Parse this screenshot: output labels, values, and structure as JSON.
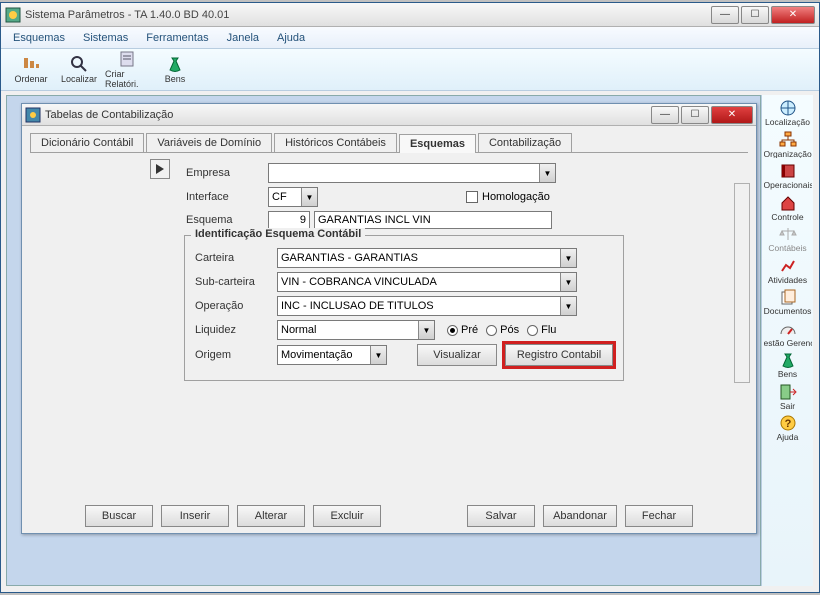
{
  "outer": {
    "title": "Sistema Parâmetros -  TA 1.40.0 BD 40.01",
    "menu": [
      "Esquemas",
      "Sistemas",
      "Ferramentas",
      "Janela",
      "Ajuda"
    ],
    "toolbar": [
      {
        "label": "Ordenar",
        "icon": "sort-icon"
      },
      {
        "label": "Localizar",
        "icon": "search-icon"
      },
      {
        "label": "Criar Relatóri.",
        "icon": "report-icon"
      },
      {
        "label": "Bens",
        "icon": "money-bag-icon"
      }
    ],
    "sidebar": [
      {
        "label": "Localização",
        "icon": "globe-icon"
      },
      {
        "label": "Organização",
        "icon": "org-icon"
      },
      {
        "label": "Operacionais",
        "icon": "book-icon"
      },
      {
        "label": "Controle",
        "icon": "house-icon"
      },
      {
        "label": "Contábeis",
        "icon": "scale-icon",
        "disabled": true
      },
      {
        "label": "Atividades",
        "icon": "activity-icon"
      },
      {
        "label": "Documentos",
        "icon": "docs-icon"
      },
      {
        "label": "estão Gerenc",
        "icon": "gauge-icon"
      },
      {
        "label": "Bens",
        "icon": "money-bag-icon"
      },
      {
        "label": "Sair",
        "icon": "exit-icon"
      },
      {
        "label": "Ajuda",
        "icon": "help-icon"
      }
    ]
  },
  "inner": {
    "title": "Tabelas de Contabilização",
    "tabs": [
      "Dicionário Contábil",
      "Variáveis de Domínio",
      "Históricos Contábeis",
      "Esquemas",
      "Contabilização"
    ],
    "active_tab": "Esquemas",
    "form": {
      "empresa_label": "Empresa",
      "empresa": "",
      "interface_label": "Interface",
      "interface": "CF",
      "homolog_label": "Homologação",
      "homolog": false,
      "esquema_label": "Esquema",
      "esquema_num": "9",
      "esquema_text": "GARANTIAS INCL VIN",
      "fieldset_legend": "Identificação Esquema Contábil",
      "carteira_label": "Carteira",
      "carteira": "GARANTIAS - GARANTIAS",
      "subcarteira_label": "Sub-carteira",
      "subcarteira": "VIN - COBRANCA VINCULADA",
      "operacao_label": "Operação",
      "operacao": "INC - INCLUSAO DE TITULOS",
      "liquidez_label": "Liquidez",
      "liquidez": "Normal",
      "radios": [
        "Pré",
        "Pós",
        "Flu"
      ],
      "radio_selected": "Pré",
      "origem_label": "Origem",
      "origem": "Movimentação",
      "visualizar_btn": "Visualizar",
      "registro_btn": "Registro Contabil"
    },
    "buttons": {
      "buscar": "Buscar",
      "inserir": "Inserir",
      "alterar": "Alterar",
      "excluir": "Excluir",
      "salvar": "Salvar",
      "abandonar": "Abandonar",
      "fechar": "Fechar"
    }
  }
}
